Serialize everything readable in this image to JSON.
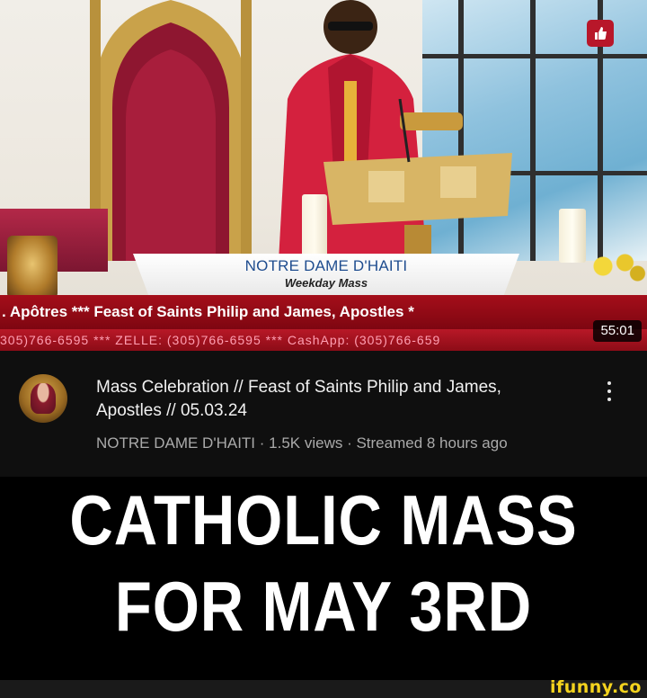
{
  "thumbnail": {
    "lower_third_title": "NOTRE DAME D'HAITI",
    "lower_third_subtitle": "Weekday Mass",
    "ticker_line_1": ". Apôtres     ***    Feast of Saints Philip and James, Apostles   *",
    "ticker_line_2": "305)766-6595  ***  ZELLE: (305)766-6595  ***  CashApp: (305)766-659",
    "duration": "55:01",
    "like_icon": "thumbs-up-icon"
  },
  "video": {
    "title": "Mass Celebration // Feast of Saints Philip and James, Apostles // 05.03.24",
    "info": "NOTRE DAME D'HAITI · 1.5K views · Streamed 8 hours ago",
    "menu_icon": "kebab-menu-icon"
  },
  "caption": {
    "line1": "CATHOLIC MASS",
    "line2": "FOR MAY 3RD"
  },
  "watermark": "ifunny.co",
  "colors": {
    "ticker_red": "#a50e1a",
    "lower_third_blue": "#1f4d8f",
    "watermark_yellow": "#f4d31e",
    "meta_background": "#0f0f0f"
  }
}
